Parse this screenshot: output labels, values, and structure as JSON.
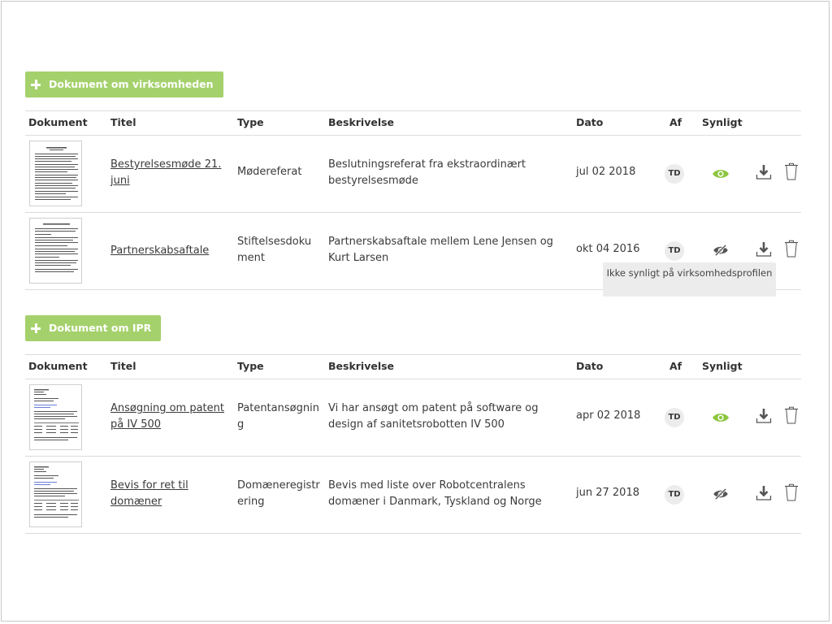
{
  "colors": {
    "accent": "#a5d16c",
    "visible_eye": "#8cc63f",
    "hidden_eye": "#555555"
  },
  "columns": {
    "document": "Dokument",
    "title": "Titel",
    "type": "Type",
    "description": "Beskrivelse",
    "date": "Dato",
    "by": "Af",
    "visible": "Synligt"
  },
  "sections": [
    {
      "add_button": "Dokument om virksomheden",
      "rows": [
        {
          "title": "Bestyrelsesmøde 21. juni",
          "type": "Mødereferat",
          "description": "Beslutningsreferat fra ekstraordinært bestyrelsesmøde",
          "date": "jul 02 2018",
          "by": "TD",
          "visible": true,
          "eye_icon": "eye-icon",
          "download_icon": "download-icon",
          "delete_icon": "trash-icon"
        },
        {
          "title": "Partnerskabsaftale",
          "type": "Stiftelsesdokument",
          "description": "Partnerskabsaftale mellem Lene Jensen og Kurt Larsen",
          "date": "okt 04 2016",
          "by": "TD",
          "visible": false,
          "eye_icon": "eye-off-icon",
          "download_icon": "download-icon",
          "delete_icon": "trash-icon"
        }
      ]
    },
    {
      "add_button": "Dokument om IPR",
      "rows": [
        {
          "title": "Ansøgning om patent på IV 500",
          "type": "Patentansøgning",
          "description": "Vi har ansøgt om patent på software og design af sanitetsrobotten IV 500",
          "date": "apr 02 2018",
          "by": "TD",
          "visible": true,
          "eye_icon": "eye-icon",
          "download_icon": "download-icon",
          "delete_icon": "trash-icon"
        },
        {
          "title": "Bevis for ret til domæner",
          "type": "Domæneregistrering",
          "description": "Bevis med liste over Robotcentralens domæner i Danmark, Tyskland og Norge",
          "date": "jun 27 2018",
          "by": "TD",
          "visible": false,
          "eye_icon": "eye-off-icon",
          "download_icon": "download-icon",
          "delete_icon": "trash-icon"
        }
      ]
    }
  ],
  "tooltip": {
    "text": "Ikke synligt på virksomhedsprofilen"
  }
}
